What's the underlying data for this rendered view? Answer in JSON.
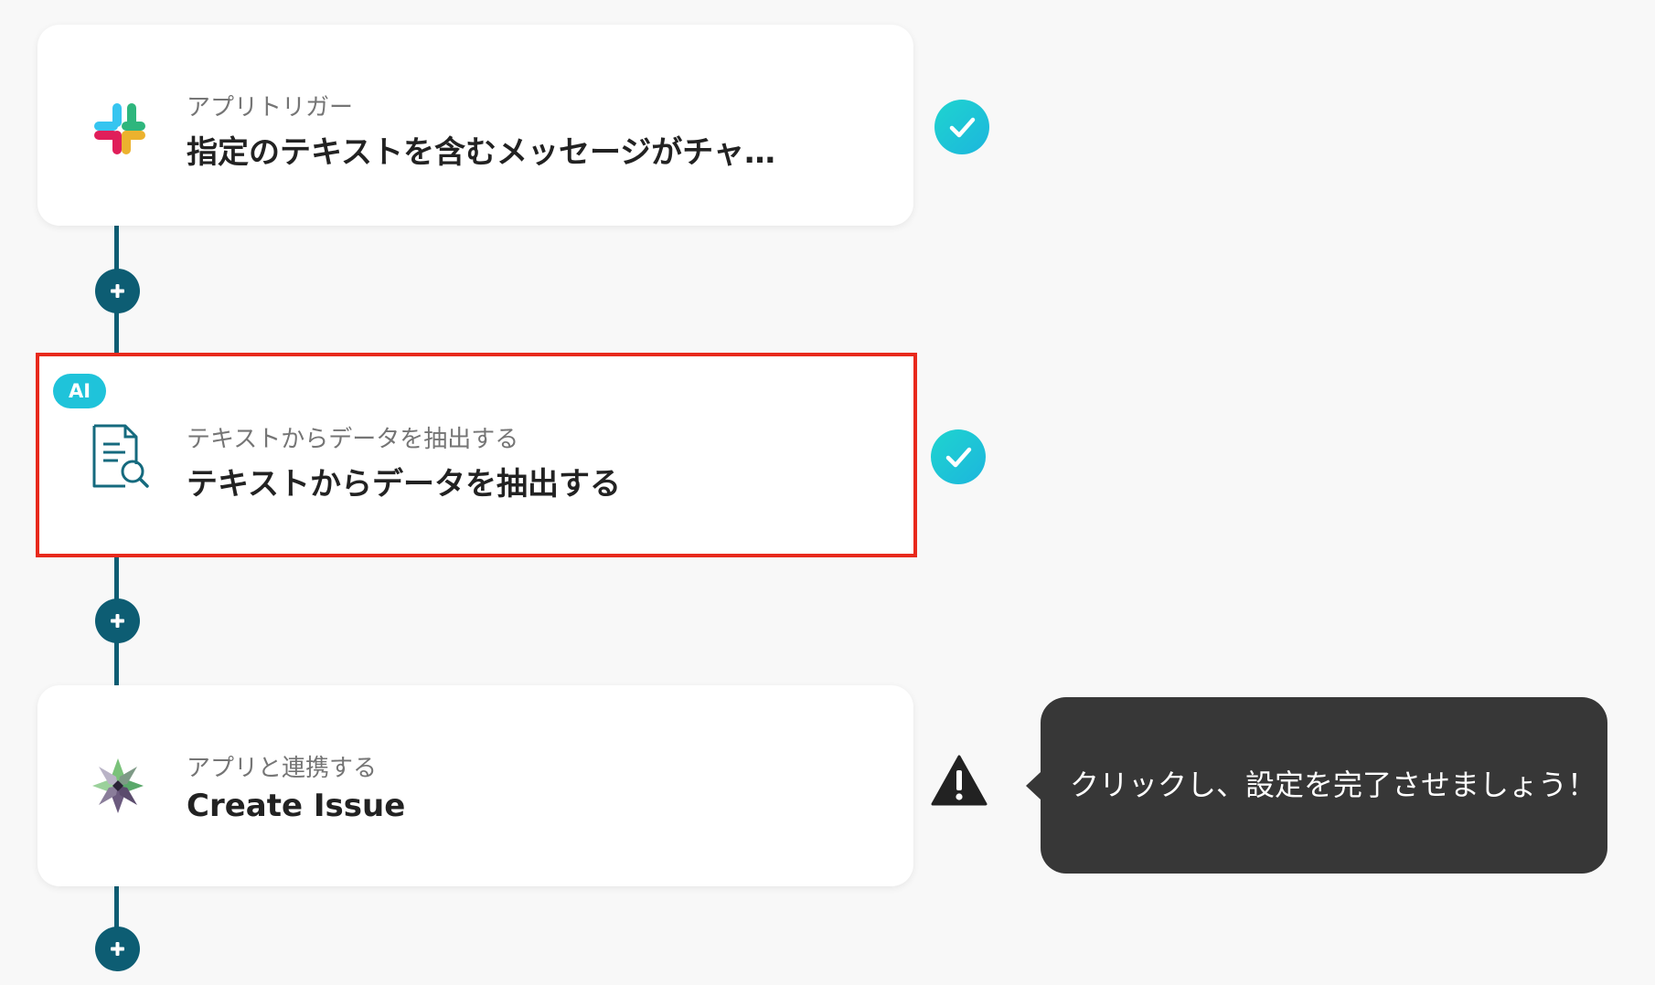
{
  "flow": {
    "steps": [
      {
        "label": "アプリトリガー",
        "title": "指定のテキストを含むメッセージがチャ…",
        "icon": "slack-icon",
        "status": "check-icon"
      },
      {
        "badge": "AI",
        "label": "テキストからデータを抽出する",
        "title": "テキストからデータを抽出する",
        "icon": "document-search-icon",
        "status": "check-icon"
      },
      {
        "label": "アプリと連携する",
        "title": "Create Issue",
        "icon": "app-logo-icon",
        "status": "warning-icon"
      }
    ],
    "add_step_icon": "plus-icon"
  },
  "tooltip": {
    "text": "クリックし、設定を完了させましょう！"
  },
  "colors": {
    "background": "#f8f8f8",
    "connector": "#0d5d73",
    "accent": "#1fc3da",
    "selection": "#e8291c",
    "tooltip": "#373737"
  }
}
